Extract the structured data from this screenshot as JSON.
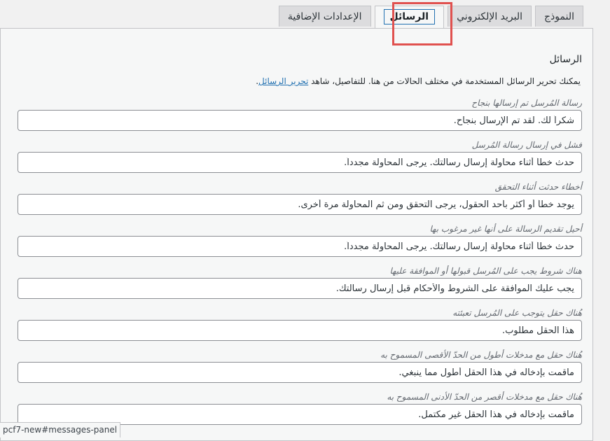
{
  "tabs": [
    {
      "label": "النموذج",
      "active": false
    },
    {
      "label": "البريد الإلكتروني",
      "active": false
    },
    {
      "label": "الرسائل",
      "active": true
    },
    {
      "label": "الإعدادات الإضافية",
      "active": false
    }
  ],
  "panel": {
    "title": "الرسائل",
    "description": "يمكنك تحرير الرسائل المستخدمة في مختلف الحالات من هنا. للتفاصيل، شاهد",
    "description_link": "تحرير الرسائل",
    "description_end": "."
  },
  "fields": [
    {
      "label": "رسالة المُرسل تم إرسالها بنجاح",
      "value": "شكراً لك. لقد تم الإرسال بنجاح."
    },
    {
      "label": "فشل في إرسال رسالة المُرسل",
      "value": "حدث خطأ أثناء محاولة إرسال رسالتك. يرجى المحاولة مجدداً."
    },
    {
      "label": "أخطاء حدثت أثناء التحقق",
      "value": "يوجد خطأ أو أكثر بأحد الحقول، يرجى التحقق ومن ثم المحاولة مرة أخرى."
    },
    {
      "label": "أحيل تقديم الرسالة على أنها غير مرغوب بها",
      "value": "حدث خطأ أثناء محاولة إرسال رسالتك. يرجى المحاولة مجدداً."
    },
    {
      "label": "هناك شروط يجب على المُرسل قبولها أو الموافقة عليها",
      "value": "يجب عليك الموافقة على الشروط والأحكام قبل إرسال رسالتك."
    },
    {
      "label": "هُناك حقل يتوجب على المُرسل تعبئته",
      "value": "هذا الحقل مطلوب."
    },
    {
      "label": "هُناك حقل مع مدخلات أطول من الحدّ الأقصى المسموح به",
      "value": "ماقمت بإدخاله في هذا الحقل أطول مما ينبغي."
    },
    {
      "label": "هُناك حقل مع مدخلات أقصر من الحدّ الأدنى المسموح به",
      "value": "ماقمت بإدخاله في هذا الحقل غير مكتمل."
    }
  ],
  "status_bar": {
    "url": "pcf7-new#messages-panel"
  }
}
